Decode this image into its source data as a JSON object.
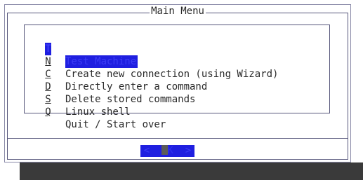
{
  "dialog": {
    "title": "Main Menu"
  },
  "menu": {
    "items": [
      {
        "key": "T",
        "label": "Test Machine",
        "selected": true
      },
      {
        "key": "N",
        "label": "Create new connection (using Wizard)",
        "selected": false
      },
      {
        "key": "C",
        "label": "Directly enter a command",
        "selected": false
      },
      {
        "key": "D",
        "label": "Delete stored commands",
        "selected": false
      },
      {
        "key": "S",
        "label": "Linux shell",
        "selected": false
      },
      {
        "key": "Q",
        "label": "Quit / Start over",
        "selected": false
      }
    ]
  },
  "buttons": {
    "ok_left": "<",
    "ok_label": "OK",
    "ok_right": ">"
  },
  "colors": {
    "highlight": "#1f1fe0",
    "frame": "#55557a",
    "shadow": "#3a3a3a"
  }
}
